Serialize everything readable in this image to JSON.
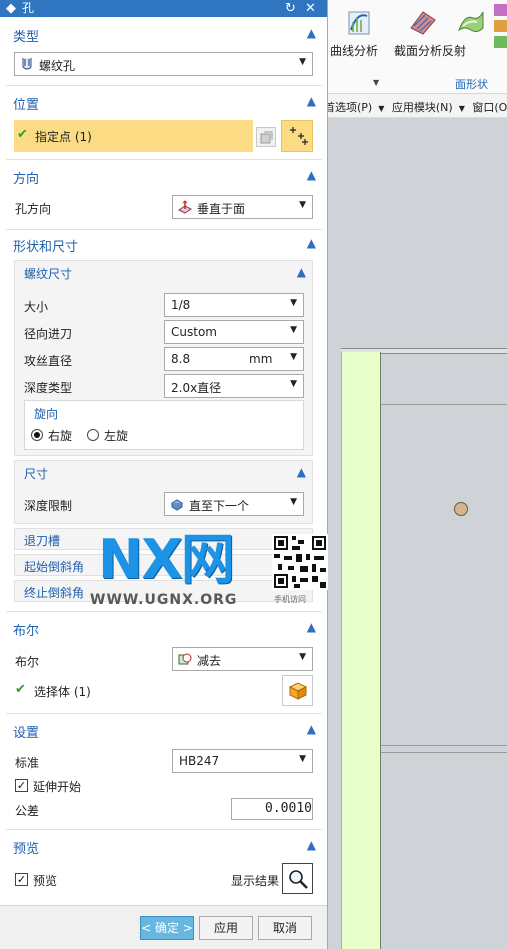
{
  "dialog": {
    "title": "孔",
    "title_buttons": {
      "reset": "↻",
      "close": "✕"
    },
    "sections": {
      "type": {
        "title": "类型",
        "value": "螺纹孔"
      },
      "position": {
        "title": "位置",
        "specify_point": "指定点 (1)"
      },
      "direction": {
        "title": "方向",
        "label": "孔方向",
        "value": "垂直于面"
      },
      "shape_size": {
        "title": "形状和尺寸",
        "thread_size": {
          "title": "螺纹尺寸",
          "rows": [
            {
              "label": "大小",
              "value": "1/8"
            },
            {
              "label": "径向进刀",
              "value": "Custom"
            },
            {
              "label": "攻丝直径",
              "value": "8.8",
              "unit": "mm"
            },
            {
              "label": "深度类型",
              "value": "2.0x直径"
            }
          ],
          "rotation": {
            "title": "旋向",
            "options": [
              {
                "label": "右旋",
                "selected": true
              },
              {
                "label": "左旋",
                "selected": false
              }
            ]
          }
        },
        "dimensions": {
          "title": "尺寸",
          "depth_limit_label": "深度限制",
          "depth_limit_value": "直至下一个"
        },
        "collapsed": [
          "退刀槽",
          "起始倒斜角",
          "终止倒斜角"
        ]
      },
      "boolean": {
        "title": "布尔",
        "label": "布尔",
        "value": "减去",
        "select_body": "选择体 (1)"
      },
      "settings": {
        "title": "设置",
        "standard_label": "标准",
        "standard_value": "HB247",
        "extend_start": {
          "label": "延伸开始",
          "checked": true
        },
        "tolerance_label": "公差",
        "tolerance_value": "0.0010"
      },
      "preview": {
        "title": "预览",
        "preview_check": {
          "label": "预览",
          "checked": true
        },
        "show_result": "显示结果"
      }
    },
    "buttons": {
      "ok": "< 确定 >",
      "apply": "应用",
      "cancel": "取消"
    }
  },
  "background_app": {
    "ribbon_buttons": [
      "曲线分析",
      "截面分析",
      "反射"
    ],
    "ribbon_group": "面形状",
    "menu": [
      "首选项(P)",
      "应用模块(N)",
      "窗口(O)"
    ]
  },
  "watermark": {
    "logo": "NX网",
    "url": "WWW.UGNX.ORG",
    "sub": "手机访问"
  },
  "colors": {
    "title_bar": "#2f75bf",
    "section_title": "#1f5fae",
    "highlight_row": "#fbdc85",
    "ok_button": "#67b6e0",
    "part_green": "#e8ffcc",
    "viewport_grey": "#cfd3d7"
  }
}
